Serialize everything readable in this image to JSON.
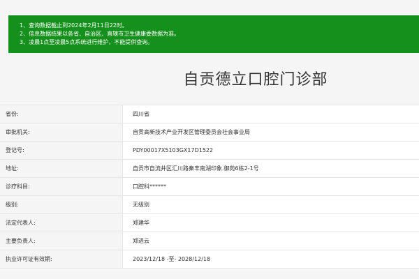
{
  "notice": {
    "lines": [
      "1、查询数据截止到2024年2月11日22时。",
      "2、信息数据结果以各省、自治区、直辖市卫生健康委数据为准。",
      "3、凌晨1点至凌晨5点系统进行维护，不能提供查询。"
    ]
  },
  "title": "自贡德立口腔门诊部",
  "rows": [
    {
      "label": "省份:",
      "value": "四川省"
    },
    {
      "label": "审批机关:",
      "value": "自贡高新技术产业开发区管理委员会社会事业局"
    },
    {
      "label": "登记号:",
      "value": "PDY00017X5103GX17D1522"
    },
    {
      "label": "地址:",
      "value": "自贡市自流井区汇川路秦丰南湖印象.御苑6栋2-1号"
    },
    {
      "label": "诊疗科目:",
      "value": "口腔科******"
    },
    {
      "label": "级别:",
      "value": "无级别"
    },
    {
      "label": "法定代表人:",
      "value": "郑建华"
    },
    {
      "label": "主要负责人:",
      "value": "郑进云"
    },
    {
      "label": "执业许可证有效期:",
      "value": "2023/12/18 -至- 2028/12/18"
    }
  ],
  "colors": {
    "notice_background": "#15901c",
    "title_text": "#333333",
    "border": "#e6e6e6"
  }
}
